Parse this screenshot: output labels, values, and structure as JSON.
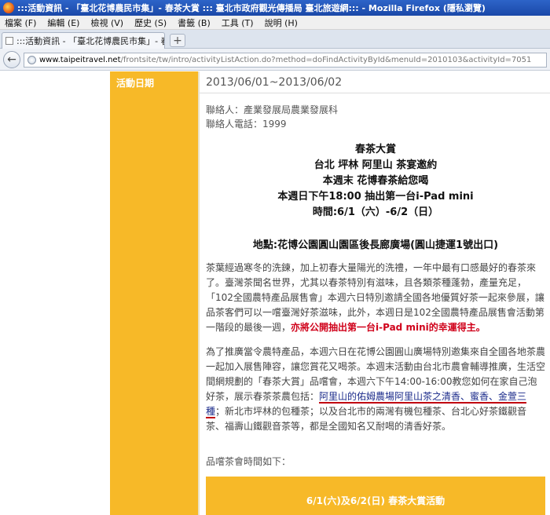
{
  "window": {
    "title": ":::活動資訊 - 「臺北花博農民市集」- 春茶大賞 ::: 臺北市政府觀光傳播局 臺北旅遊網::: - Mozilla Firefox (隱私瀏覽)"
  },
  "menu": {
    "items": [
      "檔案 (F)",
      "編輯 (E)",
      "檢視 (V)",
      "歷史 (S)",
      "書籤 (B)",
      "工具 (T)",
      "說明 (H)"
    ]
  },
  "tab": {
    "label": ":::活動資訊 - 「臺北花博農民市集」- 春⋯",
    "newtab_symbol": "+"
  },
  "nav": {
    "back_symbol": "←",
    "url_domain": "www.taipeitravel.net",
    "url_rest": "/frontsite/tw/intro/activityListAction.do?method=doFindActivityById&menuId=2010103&activityId=7051"
  },
  "page": {
    "sidebar_label": "活動日期",
    "date": "2013/06/01~2013/06/02",
    "contact_person": "聯絡人：產業發展局農業發展科",
    "contact_phone": "聯絡人電話：1999",
    "headlines": [
      "春茶大賞",
      "台北 坪林 阿里山 茶宴邀約",
      "本週末 花博春茶給您喝",
      "本週日下午18:00 抽出第一台i-Pad mini",
      "時間:6/1（六）-6/2（日）"
    ],
    "location": "地點:花博公園圓山園區後長廊廣場(圓山捷運1號出口)",
    "para1_main": "茶葉經過寒冬的洗鍊，加上初春大量陽光的洗禮，一年中最有口感最好的春茶來了。臺灣茶聞名世界，尤其以春茶特別有滋味，且各類茶種蓬勃，產量充足，「102全國農特產品展售會」本週六日特別邀請全國各地優質好茶一起來參展，讓品茶客們可以一嚐臺灣好茶滋味，此外，本週日是102全國農特產品展售會活動第一階段的最後一週，",
    "para1_red": "亦將公開抽出第一台i-Pad mini的幸運得主。",
    "para2_a": "為了推廣當令農特產品，本週六日在花博公園圓山廣場特別邀集來自全國各地茶農一起加入展售陣容，讓您賞花又喝茶。本週末活動由台北市農會輔導推廣，生活空間網規劃的「春茶大賞」品嚐會，本週六下午14:00-16:00教您如何在家自己泡好茶，展示春茶茶農包括：",
    "para2_underline": "阿里山的佑姆農場阿里山茶之清香、蜜香、金萱三種",
    "para2_b": "；新北市坪林的包種茶；以及台北市的兩灣有機包種茶、台北心好茶鐵觀音茶、福壽山鐵觀音茶等，都是全國知名又耐喝的清香好茶。",
    "tasting_label": "品嚐茶會時間如下：",
    "event_title": "6/1(六)及6/2(日) 春茶大賞活動"
  },
  "colors": {
    "accent": "#f7b928",
    "highlight_red": "#d0021b"
  }
}
